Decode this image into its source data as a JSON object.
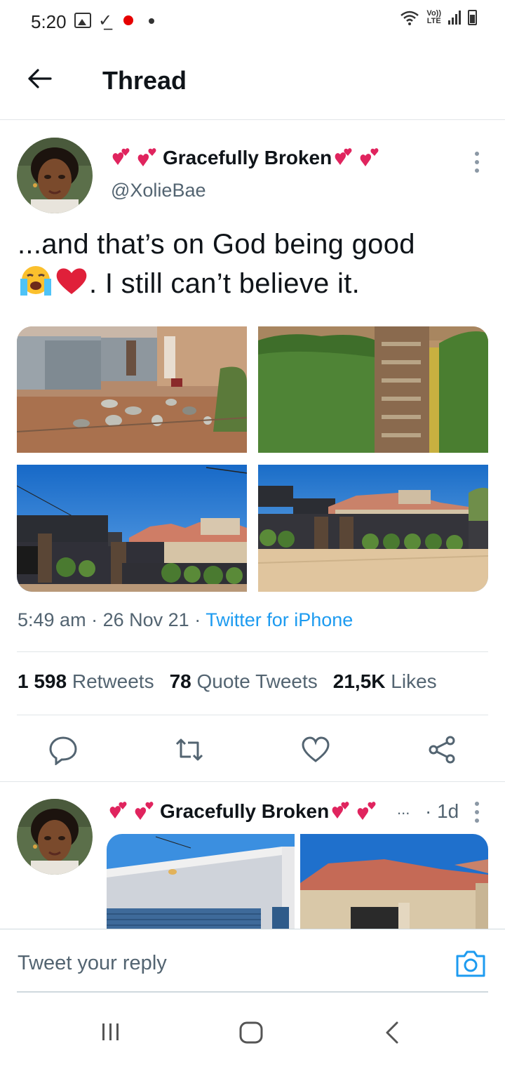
{
  "status_bar": {
    "time": "5:20",
    "network": "LTE",
    "volte": "Vo))",
    "icons": [
      "gallery-icon",
      "download-done-icon",
      "vodafone-icon",
      "notification-dot-icon",
      "wifi-icon",
      "signal-icon",
      "battery-icon"
    ]
  },
  "header": {
    "title": "Thread",
    "back_icon": "arrow-left-icon"
  },
  "tweet": {
    "display_name": "Gracefully Broken",
    "handle": "@XolieBae",
    "text_line1": "...and that’s on God being good",
    "text_line2": ". I still can’t believe it.",
    "emojis": [
      "loudly-crying-face",
      "red-heart"
    ],
    "name_decoration": "two-hearts-emoji",
    "media_count": 4,
    "media": [
      {
        "subject": "yard with corrugated iron shacks and tyres"
      },
      {
        "subject": "green hedge beside a wooden gate"
      },
      {
        "subject": "new house with dark boundary wall and plants"
      },
      {
        "subject": "new house with tiled roof from sandy yard"
      }
    ],
    "time": "5:49 am",
    "date": "26 Nov 21",
    "source": "Twitter for iPhone",
    "retweets_count": "1 598",
    "retweets_label": "Retweets",
    "quotes_count": "78",
    "quotes_label": "Quote Tweets",
    "likes_count": "21,5K",
    "likes_label": "Likes",
    "actions": [
      "reply-icon",
      "retweet-icon",
      "like-icon",
      "share-icon"
    ]
  },
  "reply_preview": {
    "display_name": "Gracefully Broken",
    "truncation": "...",
    "age": "· 1d"
  },
  "reply_bar": {
    "placeholder": "Tweet your reply",
    "camera_icon": "camera-icon"
  },
  "nav_bar": {
    "buttons": [
      "recents-icon",
      "home-icon",
      "back-icon"
    ]
  },
  "colors": {
    "accent": "#1d9bf0",
    "text": "#0f1419",
    "muted": "#536471",
    "divider": "#e1e5e8",
    "heart": "#e0245e"
  }
}
